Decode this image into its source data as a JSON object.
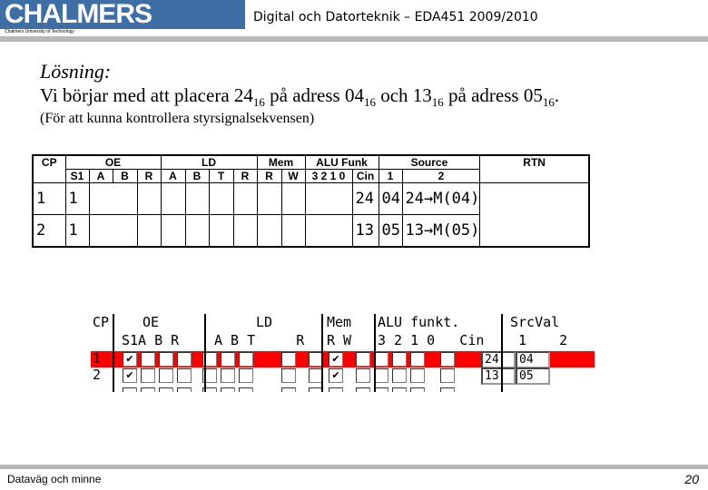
{
  "header": {
    "logo": "CHALMERS",
    "logo_sub": "Chalmers University of Technology",
    "course": "Digital och Datorteknik – EDA451 2009/2010"
  },
  "content": {
    "title": "Lösning:",
    "line1": {
      "a": "Vi börjar med att placera 24",
      "sub1": "16",
      "b": " på adress 04",
      "sub2": "16",
      "c": " och 13",
      "sub3": "16",
      "d": " på adress 05",
      "sub4": "16",
      "e": "."
    },
    "line2": "(För att kunna kontrollera styrsignalsekvensen)"
  },
  "table": {
    "groups": [
      "CP",
      "OE",
      "LD",
      "Mem",
      "ALU Funk",
      "Source",
      "RTN"
    ],
    "subheaders": [
      "S1",
      "A",
      "B",
      "R",
      "A",
      "B",
      "T",
      "R",
      "R",
      "W",
      "3 2 1 0",
      "Cin",
      "1",
      "2"
    ],
    "rows": [
      {
        "cp": "1",
        "s1": "1",
        "src1": "24",
        "src2": "04",
        "rtn": "24→M(04)"
      },
      {
        "cp": "2",
        "s1": "1",
        "src1": "13",
        "src2": "05",
        "rtn": "13→M(05)"
      }
    ]
  },
  "simulator": {
    "head1": {
      "cp": "CP",
      "oe": "OE",
      "ld": "LD",
      "mem": "Mem",
      "alu": "ALU funkt.",
      "src": "SrcVal"
    },
    "head2": {
      "oe": "S1A B R",
      "ld": "A B T     R",
      "mem": "R W",
      "alu": "3 2 1 0   Cin",
      "src": " 1    2"
    },
    "rows": [
      {
        "cp": "1",
        "highlight": true,
        "checked": [
          "S1",
          "Mem W"
        ],
        "src1": "24",
        "src2": "04"
      },
      {
        "cp": "2",
        "highlight": false,
        "checked": [
          "S1",
          "Mem W"
        ],
        "src1": "13",
        "src2": "05"
      }
    ],
    "highlight_color": "#ff0000"
  },
  "footer": {
    "left": "Dataväg och minne",
    "page": "20"
  },
  "colors": {
    "brand": "#3d6ea6",
    "bar": "#b8b8b8"
  }
}
